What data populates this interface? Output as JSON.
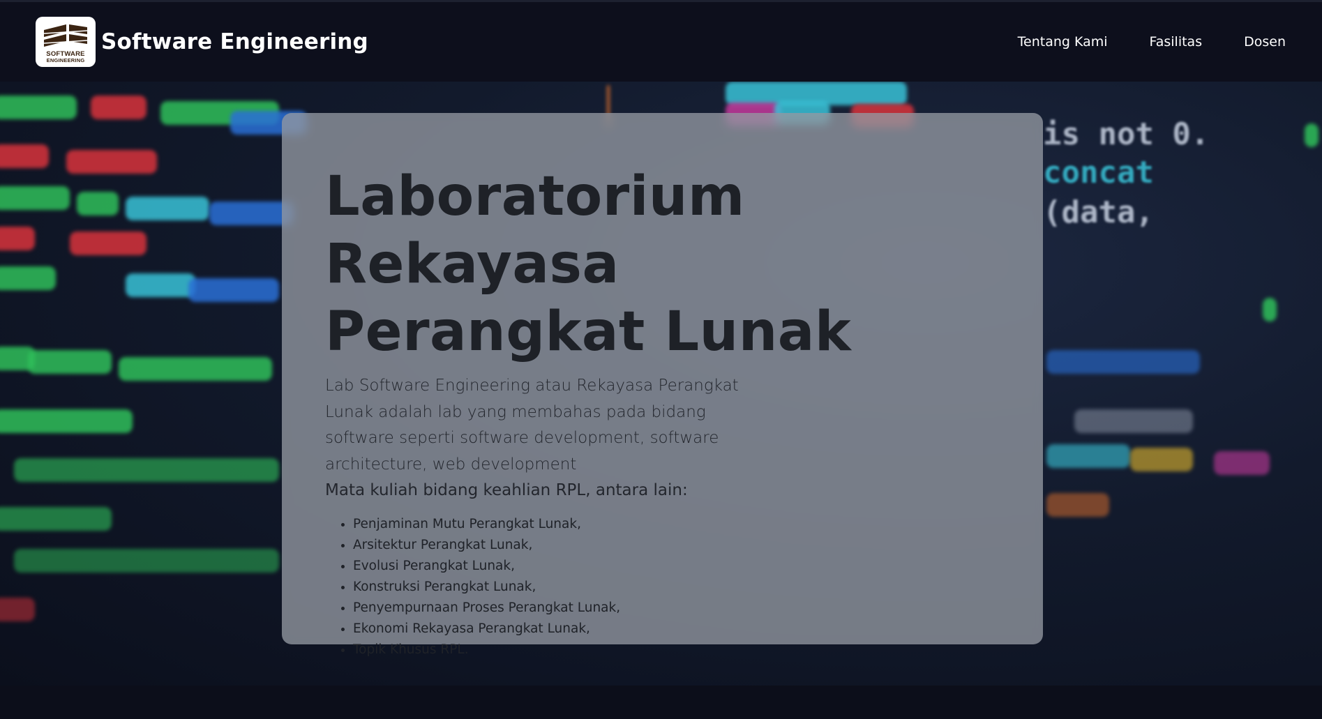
{
  "navbar": {
    "brand_title": "Software Engineering",
    "logo": {
      "text_line1": "SOFTWARE",
      "text_line2": "ENGINEERING",
      "icon": "software-engineering-logo"
    },
    "links": [
      {
        "label": "Tentang Kami"
      },
      {
        "label": "Fasilitas"
      },
      {
        "label": "Dosen"
      }
    ]
  },
  "hero": {
    "title_line1": "Laboratorium Rekayasa",
    "title_line2": "Perangkat Lunak",
    "description": "Lab Software Engineering atau Rekayasa Perangkat Lunak adalah lab yang membahas pada bidang software seperti software development, software architecture, web development",
    "courses_intro": "Mata kuliah bidang keahlian RPL, antara lain:",
    "courses": [
      "Penjaminan Mutu Perangkat Lunak,",
      "Arsitektur Perangkat Lunak,",
      "Evolusi Perangkat Lunak,",
      "Konstruksi Perangkat Lunak,",
      "Penyempurnaan Proses Perangkat Lunak,",
      "Ekonomi Rekayasa Perangkat Lunak,",
      "Topik Khusus RPL."
    ],
    "background": {
      "description_icon": "code-editor-background",
      "colors": {
        "green": "#2fbf5a",
        "blue": "#2a6fd6",
        "red": "#d8333c",
        "cyan": "#39c2d7",
        "pink": "#c43a9c"
      }
    }
  },
  "theme": {
    "navbar_bg": "#0d0f1c",
    "card_bg": "#9498a2",
    "text_dark": "#1e2127"
  }
}
